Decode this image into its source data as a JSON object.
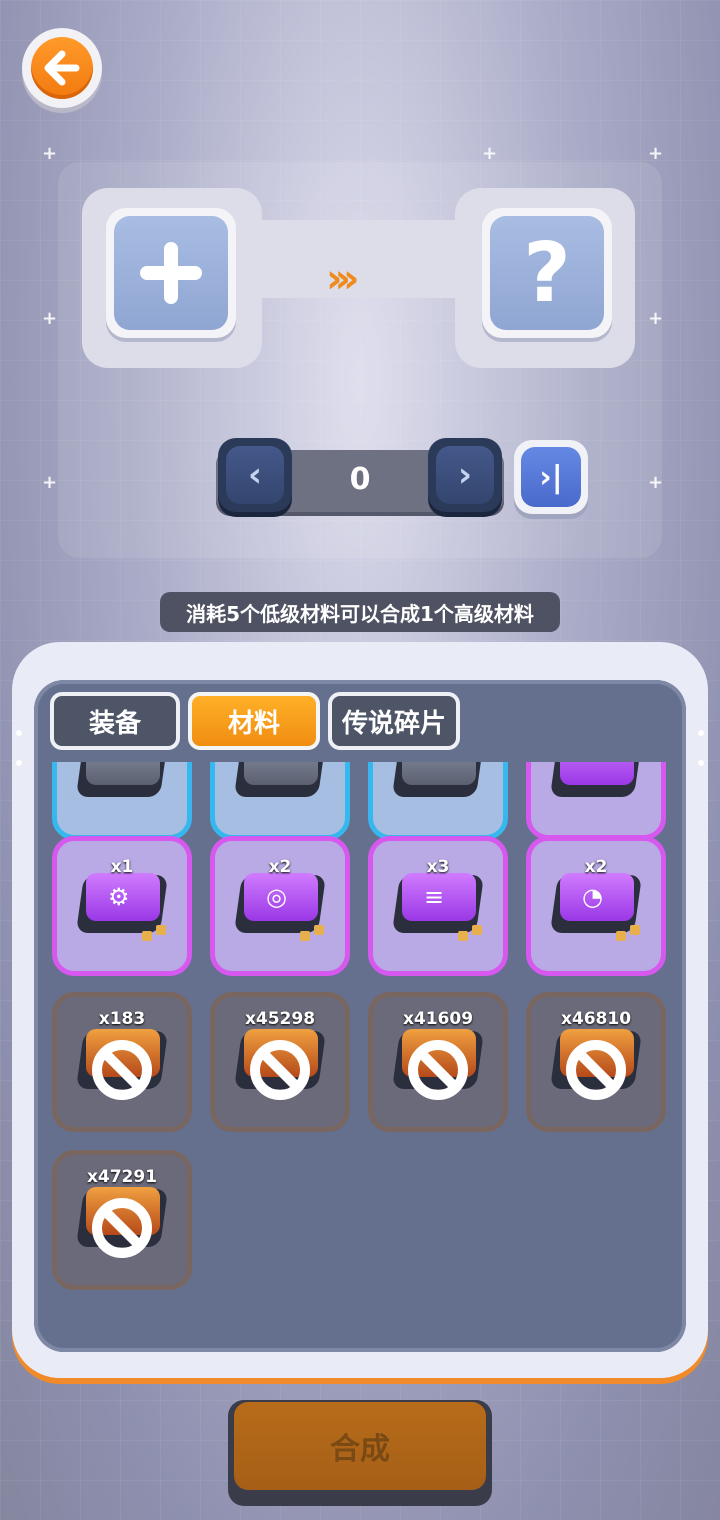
{
  "forge": {
    "input_slot_symbol": "+",
    "output_slot_symbol": "?",
    "arrow": "›››",
    "count": "0",
    "prev_symbol": "‹",
    "next_symbol": "›",
    "max_symbol": "›|"
  },
  "hint": "消耗5个低级材料可以合成1个高级材料",
  "tabs": [
    {
      "label": "装备",
      "active": false
    },
    {
      "label": "材料",
      "active": true
    },
    {
      "label": "传说碎片",
      "active": false
    }
  ],
  "items": [
    {
      "qty": "",
      "rarity": "blue"
    },
    {
      "qty": "",
      "rarity": "blue"
    },
    {
      "qty": "",
      "rarity": "blue"
    },
    {
      "qty": "",
      "rarity": "purple"
    },
    {
      "qty": "x1",
      "rarity": "purple",
      "icon": "gear-icon"
    },
    {
      "qty": "x2",
      "rarity": "purple",
      "icon": "target-icon"
    },
    {
      "qty": "x3",
      "rarity": "purple",
      "icon": "stack-icon"
    },
    {
      "qty": "x2",
      "rarity": "purple",
      "icon": "pie-icon"
    },
    {
      "qty": "x183",
      "rarity": "orange",
      "locked": true
    },
    {
      "qty": "x45298",
      "rarity": "orange",
      "locked": true
    },
    {
      "qty": "x41609",
      "rarity": "orange",
      "locked": true
    },
    {
      "qty": "x46810",
      "rarity": "orange",
      "locked": true
    },
    {
      "qty": "x47291",
      "rarity": "orange",
      "locked": true
    }
  ],
  "synthesize_label": "合成",
  "colors": {
    "accent": "#f08a1c",
    "tab_active": "#f5a21f",
    "rare_blue": "#36b7ee",
    "epic_purple": "#d658ee"
  }
}
